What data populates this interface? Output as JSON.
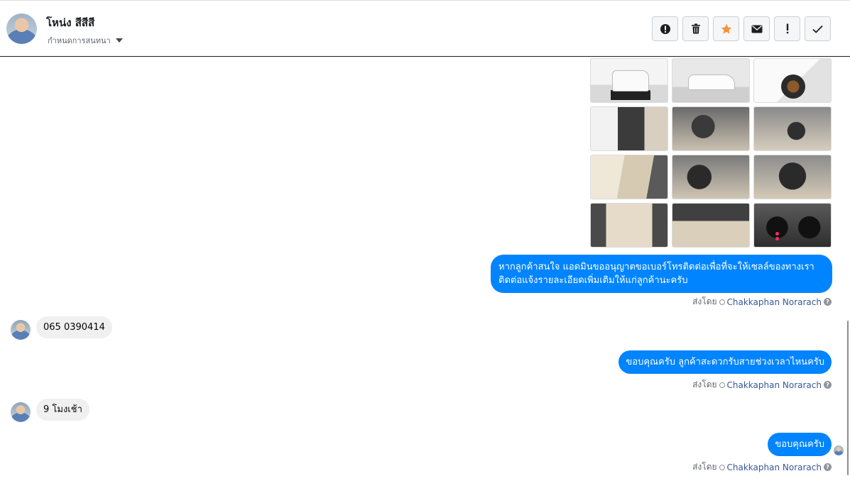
{
  "header": {
    "contact_name": "โหน่ง สีสีสี",
    "assign_label": "กำหนดการสนทนา",
    "actions": [
      {
        "id": "spam",
        "icon": "alert-circle-icon"
      },
      {
        "id": "delete",
        "icon": "trash-icon"
      },
      {
        "id": "star",
        "icon": "star-icon",
        "color": "#f7923a"
      },
      {
        "id": "unread",
        "icon": "envelope-icon"
      },
      {
        "id": "important",
        "icon": "exclamation-icon"
      },
      {
        "id": "done",
        "icon": "check-icon"
      }
    ]
  },
  "messages": [
    {
      "from": "page",
      "text": "หากลูกค้าสนใจ แอดมินขออนุญาตขอเบอร์โทรติดต่อเพื่อที่จะให้เซลล์ของทางเราติดต่อแจ้งรายละเอียดเพิ่มเติมให้แก่ลูกค้านะครับ",
      "sent_by": "ส่งโดย",
      "agent": "Chakkaphan Norarach"
    },
    {
      "from": "customer",
      "text": "065 0390414"
    },
    {
      "from": "page",
      "text": "ขอบคุณครับ ลูกค้าสะดวกรับสายช่วงเวลาไหนครับ",
      "sent_by": "ส่งโดย",
      "agent": "Chakkaphan Norarach"
    },
    {
      "from": "customer",
      "text": "9 โมงเช้า"
    },
    {
      "from": "page",
      "text": "ขอบคุณครับ",
      "sent_by": "ส่งโดย",
      "agent": "Chakkaphan Norarach"
    }
  ],
  "colors": {
    "outgoing_bubble": "#0084ff",
    "incoming_bubble": "#f0f0f0",
    "agent_link": "#385898"
  }
}
